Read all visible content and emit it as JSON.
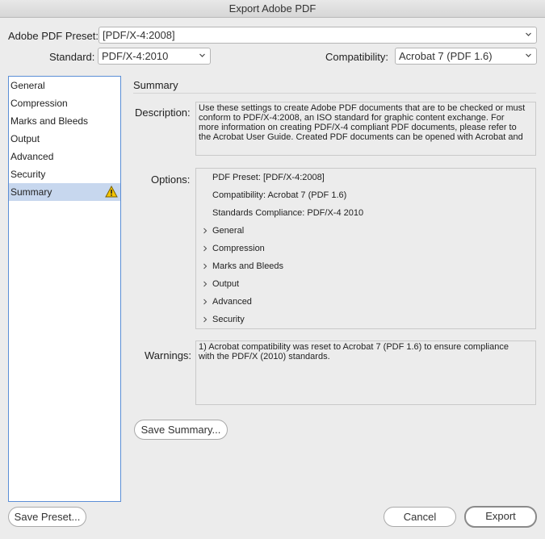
{
  "window": {
    "title": "Export Adobe PDF"
  },
  "preset": {
    "label": "Adobe PDF Preset:",
    "value": "[PDF/X-4:2008]"
  },
  "standard": {
    "label": "Standard:",
    "value": "PDF/X-4:2010"
  },
  "compatibility": {
    "label": "Compatibility:",
    "value": "Acrobat 7 (PDF 1.6)"
  },
  "sidebar": {
    "items": [
      {
        "label": "General"
      },
      {
        "label": "Compression"
      },
      {
        "label": "Marks and Bleeds"
      },
      {
        "label": "Output"
      },
      {
        "label": "Advanced"
      },
      {
        "label": "Security"
      },
      {
        "label": "Summary",
        "selected": true,
        "icon": "warning-icon"
      }
    ]
  },
  "summary": {
    "title": "Summary",
    "description_label": "Description:",
    "description_lines": [
      "Use these settings to create Adobe PDF documents that are to be checked or must",
      "conform to PDF/X-4:2008, an ISO standard for graphic content exchange.  For",
      "more information on creating PDF/X-4 compliant PDF documents, please refer to",
      "the Acrobat User Guide.  Created PDF documents can be opened with Acrobat and"
    ],
    "options_label": "Options:",
    "options": {
      "preset": "PDF Preset: [PDF/X-4:2008]",
      "compatibility": "Compatibility: Acrobat 7 (PDF 1.6)",
      "compliance": "Standards Compliance: PDF/X-4 2010",
      "groups": [
        "General",
        "Compression",
        "Marks and Bleeds",
        "Output",
        "Advanced",
        "Security"
      ]
    },
    "warnings_label": "Warnings:",
    "warnings_lines": [
      "1) Acrobat compatibility was reset to Acrobat 7 (PDF 1.6) to ensure compliance",
      "with the PDF/X (2010) standards."
    ],
    "save_summary_label": "Save Summary..."
  },
  "footer": {
    "save_preset_label": "Save Preset...",
    "cancel_label": "Cancel",
    "export_label": "Export"
  },
  "colors": {
    "selection": "#c7d7ee",
    "sidebar_border": "#5b8ed6",
    "warning": "#f5c400"
  }
}
